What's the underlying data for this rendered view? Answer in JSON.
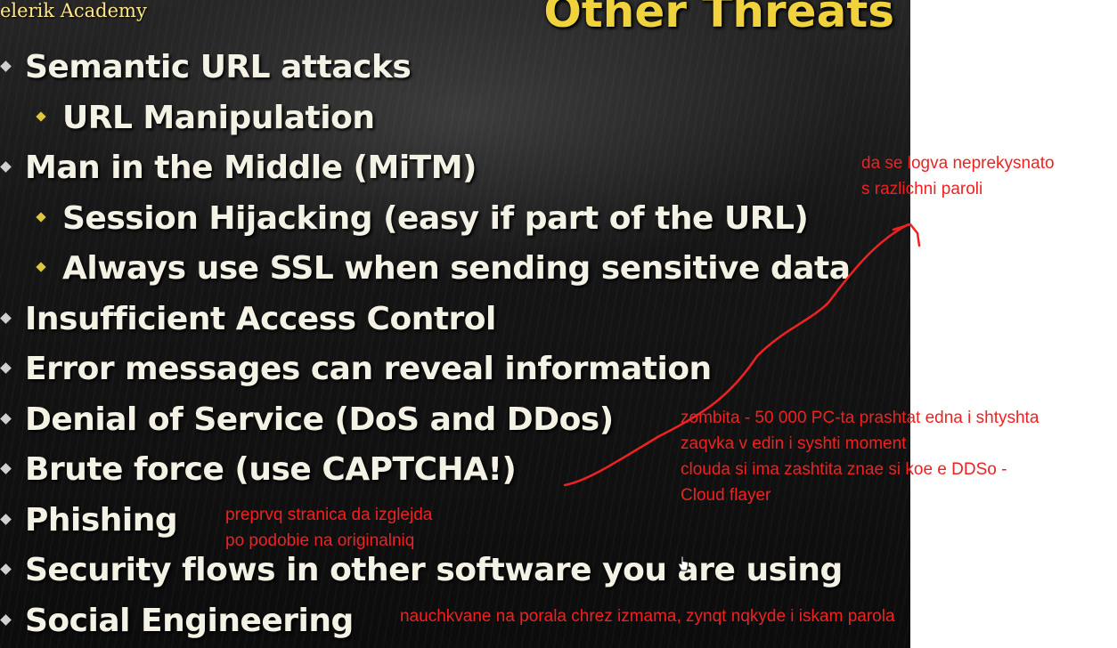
{
  "slide": {
    "logo": "elerik Academy",
    "title": "Other Threats",
    "bullets": [
      {
        "level": 1,
        "text": "Semantic URL attacks"
      },
      {
        "level": 2,
        "text": "URL Manipulation"
      },
      {
        "level": 1,
        "text": "Man in the Middle (MiTM)"
      },
      {
        "level": 2,
        "text": "Session Hijacking (easy if part of the URL)"
      },
      {
        "level": 2,
        "text": "Always use SSL when sending sensitive data"
      },
      {
        "level": 1,
        "text": "Insufficient Access Control"
      },
      {
        "level": 1,
        "text": "Error messages can reveal information"
      },
      {
        "level": 1,
        "text": "Denial of Service (DoS and DDos)"
      },
      {
        "level": 1,
        "text": "Brute force (use CAPTCHA!)"
      },
      {
        "level": 1,
        "text": "Phishing"
      },
      {
        "level": 1,
        "text": "Security flows in other software you are using"
      },
      {
        "level": 1,
        "text": "Social Engineering"
      }
    ]
  },
  "annotations": {
    "logging_note": [
      "da se logva neprekysnato",
      "s razlichni paroli"
    ],
    "zombies_note": [
      "zombita - 50 000 PC-ta prashtat edna i shtyshta",
      "zaqvka v edin i syshti moment",
      "clouda si ima zashtita znae si koe e DDSo -",
      "Cloud flayer"
    ],
    "phishing_note": [
      "preprvq stranica da izglejda",
      "po podobie na originalniq"
    ],
    "social_note": [
      "nauchkvane na porala chrez izmama, zynqt nqkyde i iskam parola"
    ]
  },
  "colors": {
    "title": "#f0d23c",
    "bullet_text": "#f4f2e4",
    "sub_marker": "#e0c63c",
    "annotation": "#ee2222"
  },
  "icons": {
    "cursor": "hand-pointer-icon",
    "arrow": "hand-drawn-arrow"
  }
}
